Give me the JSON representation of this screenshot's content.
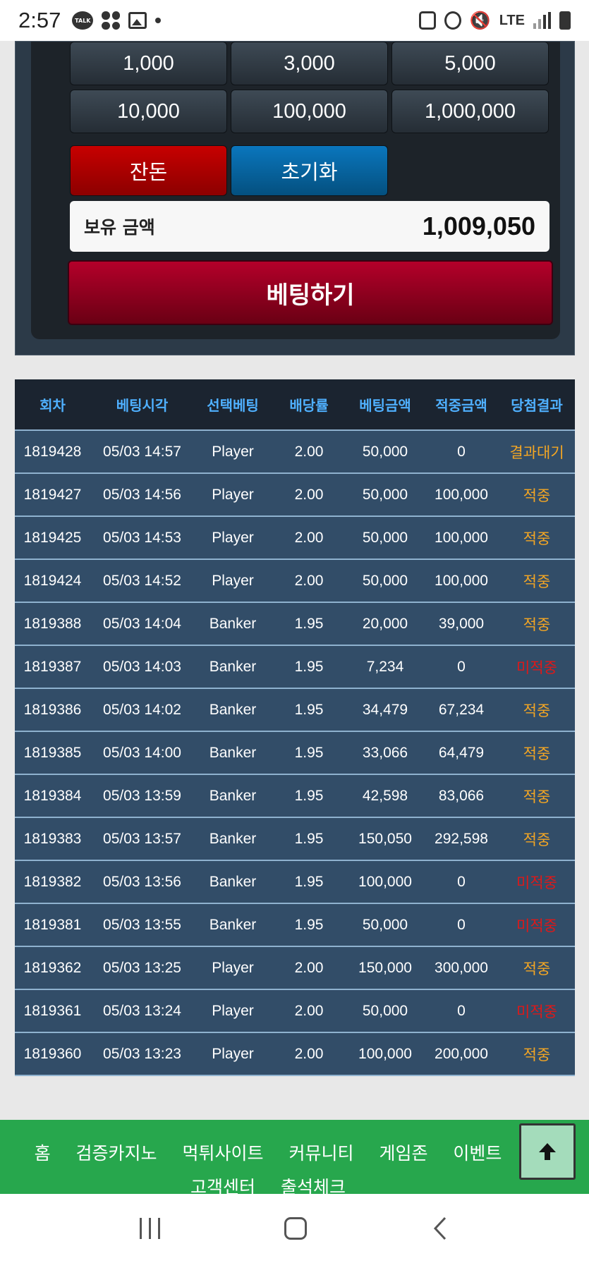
{
  "status_bar": {
    "time": "2:57",
    "talk_badge": "TALK",
    "network": "LTE"
  },
  "chips": {
    "row1": [
      "1,000",
      "3,000",
      "5,000"
    ],
    "row2": [
      "10,000",
      "100,000",
      "1,000,000"
    ],
    "change_label": "잔돈",
    "reset_label": "초기화"
  },
  "balance": {
    "label": "보유 금액",
    "amount": "1,009,050"
  },
  "bet_button": "베팅하기",
  "history": {
    "columns": [
      "회차",
      "베팅시각",
      "선택베팅",
      "배당률",
      "베팅금액",
      "적중금액",
      "당첨결과"
    ],
    "rows": [
      [
        "1819428",
        "05/03 14:57",
        "Player",
        "2.00",
        "50,000",
        "0",
        "결과대기"
      ],
      [
        "1819427",
        "05/03 14:56",
        "Player",
        "2.00",
        "50,000",
        "100,000",
        "적중"
      ],
      [
        "1819425",
        "05/03 14:53",
        "Player",
        "2.00",
        "50,000",
        "100,000",
        "적중"
      ],
      [
        "1819424",
        "05/03 14:52",
        "Player",
        "2.00",
        "50,000",
        "100,000",
        "적중"
      ],
      [
        "1819388",
        "05/03 14:04",
        "Banker",
        "1.95",
        "20,000",
        "39,000",
        "적중"
      ],
      [
        "1819387",
        "05/03 14:03",
        "Banker",
        "1.95",
        "7,234",
        "0",
        "미적중"
      ],
      [
        "1819386",
        "05/03 14:02",
        "Banker",
        "1.95",
        "34,479",
        "67,234",
        "적중"
      ],
      [
        "1819385",
        "05/03 14:00",
        "Banker",
        "1.95",
        "33,066",
        "64,479",
        "적중"
      ],
      [
        "1819384",
        "05/03 13:59",
        "Banker",
        "1.95",
        "42,598",
        "83,066",
        "적중"
      ],
      [
        "1819383",
        "05/03 13:57",
        "Banker",
        "1.95",
        "150,050",
        "292,598",
        "적중"
      ],
      [
        "1819382",
        "05/03 13:56",
        "Banker",
        "1.95",
        "100,000",
        "0",
        "미적중"
      ],
      [
        "1819381",
        "05/03 13:55",
        "Banker",
        "1.95",
        "50,000",
        "0",
        "미적중"
      ],
      [
        "1819362",
        "05/03 13:25",
        "Player",
        "2.00",
        "150,000",
        "300,000",
        "적중"
      ],
      [
        "1819361",
        "05/03 13:24",
        "Player",
        "2.00",
        "50,000",
        "0",
        "미적중"
      ],
      [
        "1819360",
        "05/03 13:23",
        "Player",
        "2.00",
        "100,000",
        "200,000",
        "적중"
      ]
    ]
  },
  "footer": {
    "links": [
      "홈",
      "검증카지노",
      "먹튀사이트",
      "커뮤니티",
      "게임존",
      "이벤트",
      "고객센터",
      "출석체크"
    ]
  },
  "colors": {
    "win": "#f4a623",
    "lose": "#e01818",
    "header_text": "#4fb0ff",
    "row_bg": "#324d68"
  },
  "icons": [
    "up-arrow-icon",
    "nav-recent-icon",
    "nav-home-icon",
    "nav-back-icon"
  ]
}
